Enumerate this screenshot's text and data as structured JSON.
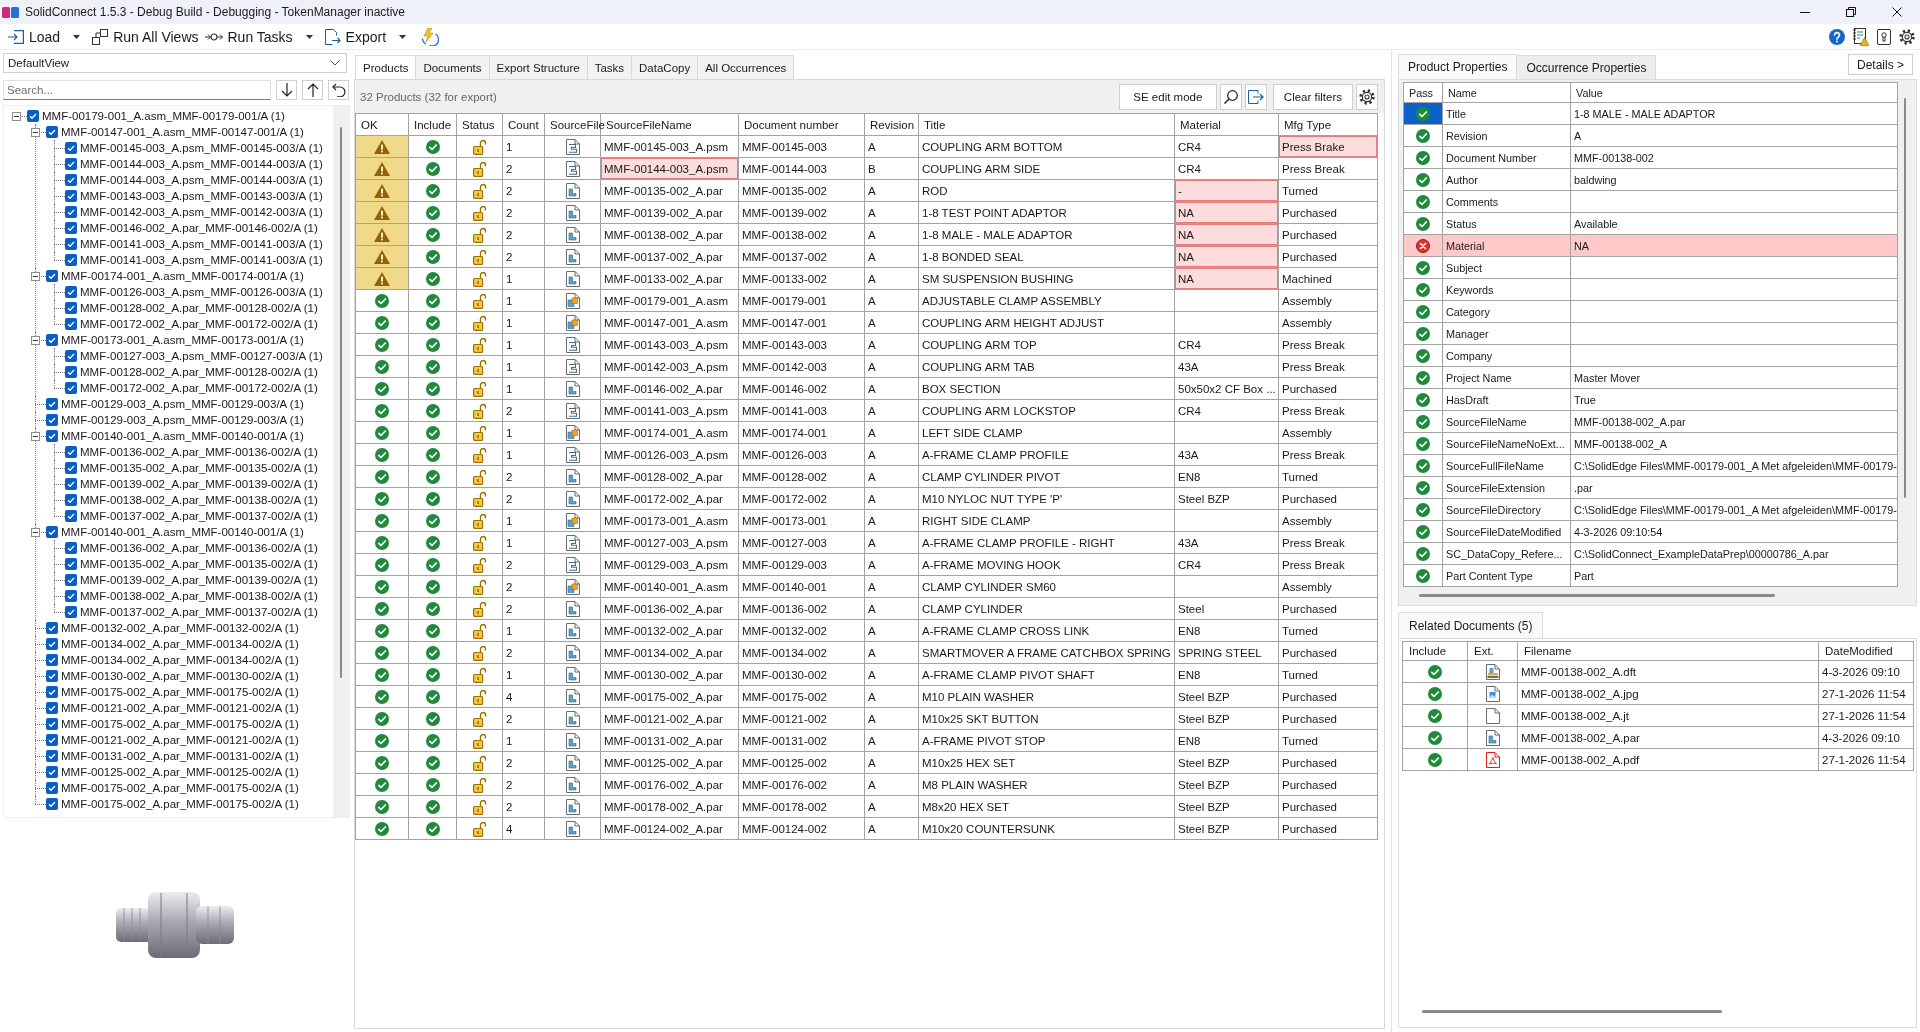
{
  "window": {
    "title": "SolidConnect 1.5.3 - Debug Build - Debugging - TokenManager inactive"
  },
  "toolbar": {
    "items": [
      {
        "label": "Load",
        "dropdown": true
      },
      {
        "label": "Run All Views",
        "dropdown": false
      },
      {
        "label": "Run Tasks",
        "dropdown": true
      },
      {
        "label": "Export",
        "dropdown": true
      }
    ]
  },
  "left_panel": {
    "view": {
      "value": "DefaultView"
    },
    "search": {
      "placeholder": "Search..."
    },
    "tree": [
      {
        "label": "MMF-00179-001_A.asm_MMF-00179-001/A (1)",
        "checked": true,
        "expanded": true,
        "children": [
          {
            "label": "MMF-00147-001_A.asm_MMF-00147-001/A (1)",
            "checked": true,
            "expanded": true,
            "children": [
              {
                "label": "MMF-00145-003_A.psm_MMF-00145-003/A (1)",
                "checked": true
              },
              {
                "label": "MMF-00144-003_A.psm_MMF-00144-003/A (1)",
                "checked": true
              },
              {
                "label": "MMF-00144-003_A.psm_MMF-00144-003/A (1)",
                "checked": true
              },
              {
                "label": "MMF-00143-003_A.psm_MMF-00143-003/A (1)",
                "checked": true
              },
              {
                "label": "MMF-00142-003_A.psm_MMF-00142-003/A (1)",
                "checked": true
              },
              {
                "label": "MMF-00146-002_A.par_MMF-00146-002/A (1)",
                "checked": true
              },
              {
                "label": "MMF-00141-003_A.psm_MMF-00141-003/A (1)",
                "checked": true
              },
              {
                "label": "MMF-00141-003_A.psm_MMF-00141-003/A (1)",
                "checked": true
              }
            ]
          },
          {
            "label": "MMF-00174-001_A.asm_MMF-00174-001/A (1)",
            "checked": true,
            "expanded": true,
            "children": [
              {
                "label": "MMF-00126-003_A.psm_MMF-00126-003/A (1)",
                "checked": true
              },
              {
                "label": "MMF-00128-002_A.par_MMF-00128-002/A (1)",
                "checked": true
              },
              {
                "label": "MMF-00172-002_A.par_MMF-00172-002/A (1)",
                "checked": true
              }
            ]
          },
          {
            "label": "MMF-00173-001_A.asm_MMF-00173-001/A (1)",
            "checked": true,
            "expanded": true,
            "children": [
              {
                "label": "MMF-00127-003_A.psm_MMF-00127-003/A (1)",
                "checked": true
              },
              {
                "label": "MMF-00128-002_A.par_MMF-00128-002/A (1)",
                "checked": true
              },
              {
                "label": "MMF-00172-002_A.par_MMF-00172-002/A (1)",
                "checked": true
              }
            ]
          },
          {
            "label": "MMF-00129-003_A.psm_MMF-00129-003/A (1)",
            "checked": true
          },
          {
            "label": "MMF-00129-003_A.psm_MMF-00129-003/A (1)",
            "checked": true
          },
          {
            "label": "MMF-00140-001_A.asm_MMF-00140-001/A (1)",
            "checked": true,
            "expanded": true,
            "children": [
              {
                "label": "MMF-00136-002_A.par_MMF-00136-002/A (1)",
                "checked": true
              },
              {
                "label": "MMF-00135-002_A.par_MMF-00135-002/A (1)",
                "checked": true
              },
              {
                "label": "MMF-00139-002_A.par_MMF-00139-002/A (1)",
                "checked": true
              },
              {
                "label": "MMF-00138-002_A.par_MMF-00138-002/A (1)",
                "checked": true
              },
              {
                "label": "MMF-00137-002_A.par_MMF-00137-002/A (1)",
                "checked": true
              }
            ]
          },
          {
            "label": "MMF-00140-001_A.asm_MMF-00140-001/A (1)",
            "checked": true,
            "expanded": true,
            "children": [
              {
                "label": "MMF-00136-002_A.par_MMF-00136-002/A (1)",
                "checked": true
              },
              {
                "label": "MMF-00135-002_A.par_MMF-00135-002/A (1)",
                "checked": true
              },
              {
                "label": "MMF-00139-002_A.par_MMF-00139-002/A (1)",
                "checked": true
              },
              {
                "label": "MMF-00138-002_A.par_MMF-00138-002/A (1)",
                "checked": true
              },
              {
                "label": "MMF-00137-002_A.par_MMF-00137-002/A (1)",
                "checked": true
              }
            ]
          },
          {
            "label": "MMF-00132-002_A.par_MMF-00132-002/A (1)",
            "checked": true
          },
          {
            "label": "MMF-00134-002_A.par_MMF-00134-002/A (1)",
            "checked": true
          },
          {
            "label": "MMF-00134-002_A.par_MMF-00134-002/A (1)",
            "checked": true
          },
          {
            "label": "MMF-00130-002_A.par_MMF-00130-002/A (1)",
            "checked": true
          },
          {
            "label": "MMF-00175-002_A.par_MMF-00175-002/A (1)",
            "checked": true
          },
          {
            "label": "MMF-00121-002_A.par_MMF-00121-002/A (1)",
            "checked": true
          },
          {
            "label": "MMF-00175-002_A.par_MMF-00175-002/A (1)",
            "checked": true
          },
          {
            "label": "MMF-00121-002_A.par_MMF-00121-002/A (1)",
            "checked": true
          },
          {
            "label": "MMF-00131-002_A.par_MMF-00131-002/A (1)",
            "checked": true
          },
          {
            "label": "MMF-00125-002_A.par_MMF-00125-002/A (1)",
            "checked": true
          },
          {
            "label": "MMF-00175-002_A.par_MMF-00175-002/A (1)",
            "checked": true
          },
          {
            "label": "MMF-00175-002_A.par_MMF-00175-002/A (1)",
            "checked": true
          }
        ]
      }
    ]
  },
  "products_panel": {
    "tabs": [
      {
        "label": "Products",
        "selected": true
      },
      {
        "label": "Documents",
        "selected": false
      },
      {
        "label": "Export Structure",
        "selected": false
      },
      {
        "label": "Tasks",
        "selected": false
      },
      {
        "label": "DataCopy",
        "selected": false
      },
      {
        "label": "All Occurrences",
        "selected": false
      }
    ],
    "summary": "32 Products (32 for export)",
    "edit_mode_button": "SE edit mode",
    "clear_filters_button": "Clear filters",
    "table": {
      "columns": [
        "OK",
        "Include",
        "Status",
        "Count",
        "SourceFile",
        "SourceFileName",
        "Document number",
        "Revision",
        "Title",
        "Material",
        "Mfg Type"
      ],
      "rows": [
        {
          "ok": false,
          "include": true,
          "count": "1",
          "kind": "sheetmetal",
          "source_file_name": "MMF-00145-003_A.psm",
          "document_number": "MMF-00145-003",
          "revision": "A",
          "title": "COUPLING ARM BOTTOM",
          "material": "CR4",
          "mfg_type": "Press Brake",
          "file_name_error": false,
          "material_error": false,
          "mfg_type_error": true
        },
        {
          "ok": false,
          "include": true,
          "count": "2",
          "kind": "sheetmetal",
          "source_file_name": "MMF-00144-003_A.psm",
          "document_number": "MMF-00144-003",
          "revision": "B",
          "title": "COUPLING ARM SIDE",
          "material": "CR4",
          "mfg_type": "Press Break",
          "file_name_error": true,
          "material_error": false,
          "mfg_type_error": false
        },
        {
          "ok": false,
          "include": true,
          "count": "2",
          "kind": "part",
          "source_file_name": "MMF-00135-002_A.par",
          "document_number": "MMF-00135-002",
          "revision": "A",
          "title": "ROD",
          "material": "-",
          "mfg_type": "Turned",
          "file_name_error": false,
          "material_error": true,
          "mfg_type_error": false
        },
        {
          "ok": false,
          "include": true,
          "count": "2",
          "kind": "part",
          "source_file_name": "MMF-00139-002_A.par",
          "document_number": "MMF-00139-002",
          "revision": "A",
          "title": "1-8 TEST POINT ADAPTOR",
          "material": "NA",
          "mfg_type": "Purchased",
          "file_name_error": false,
          "material_error": true,
          "mfg_type_error": false
        },
        {
          "ok": false,
          "include": true,
          "count": "2",
          "kind": "part",
          "source_file_name": "MMF-00138-002_A.par",
          "document_number": "MMF-00138-002",
          "revision": "A",
          "title": "1-8 MALE - MALE ADAPTOR",
          "material": "NA",
          "mfg_type": "Purchased",
          "file_name_error": false,
          "material_error": true,
          "mfg_type_error": false
        },
        {
          "ok": false,
          "include": true,
          "count": "2",
          "kind": "part",
          "source_file_name": "MMF-00137-002_A.par",
          "document_number": "MMF-00137-002",
          "revision": "A",
          "title": "1-8 BONDED SEAL",
          "material": "NA",
          "mfg_type": "Purchased",
          "file_name_error": false,
          "material_error": true,
          "mfg_type_error": false
        },
        {
          "ok": false,
          "include": true,
          "count": "1",
          "kind": "part",
          "source_file_name": "MMF-00133-002_A.par",
          "document_number": "MMF-00133-002",
          "revision": "A",
          "title": "SM SUSPENSION BUSHING",
          "material": "NA",
          "mfg_type": "Machined",
          "file_name_error": false,
          "material_error": true,
          "mfg_type_error": false
        },
        {
          "ok": true,
          "include": true,
          "count": "1",
          "kind": "assembly",
          "source_file_name": "MMF-00179-001_A.asm",
          "document_number": "MMF-00179-001",
          "revision": "A",
          "title": "ADJUSTABLE CLAMP ASSEMBLY",
          "mfg_type": "Assembly",
          "file_name_error": false,
          "material_error": false,
          "mfg_type_error": false
        },
        {
          "ok": true,
          "include": true,
          "count": "1",
          "kind": "assembly",
          "source_file_name": "MMF-00147-001_A.asm",
          "document_number": "MMF-00147-001",
          "revision": "A",
          "title": "COUPLING ARM HEIGHT ADJUST",
          "mfg_type": "Assembly",
          "file_name_error": false,
          "material_error": false,
          "mfg_type_error": false
        },
        {
          "ok": true,
          "include": true,
          "count": "1",
          "kind": "sheetmetal",
          "source_file_name": "MMF-00143-003_A.psm",
          "document_number": "MMF-00143-003",
          "revision": "A",
          "title": "COUPLING ARM TOP",
          "material": "CR4",
          "mfg_type": "Press Break",
          "file_name_error": false,
          "material_error": false,
          "mfg_type_error": false
        },
        {
          "ok": true,
          "include": true,
          "count": "1",
          "kind": "sheetmetal",
          "source_file_name": "MMF-00142-003_A.psm",
          "document_number": "MMF-00142-003",
          "revision": "A",
          "title": "COUPLING ARM TAB",
          "material": "43A",
          "mfg_type": "Press Break",
          "file_name_error": false,
          "material_error": false,
          "mfg_type_error": false
        },
        {
          "ok": true,
          "include": true,
          "count": "1",
          "kind": "part",
          "source_file_name": "MMF-00146-002_A.par",
          "document_number": "MMF-00146-002",
          "revision": "A",
          "title": "BOX SECTION",
          "material": "50x50x2 CF Box ...",
          "mfg_type": "Purchased",
          "file_name_error": false,
          "material_error": false,
          "mfg_type_error": false
        },
        {
          "ok": true,
          "include": true,
          "count": "2",
          "kind": "sheetmetal",
          "source_file_name": "MMF-00141-003_A.psm",
          "document_number": "MMF-00141-003",
          "revision": "A",
          "title": "COUPLING ARM LOCKSTOP",
          "material": "CR4",
          "mfg_type": "Press Break",
          "file_name_error": false,
          "material_error": false,
          "mfg_type_error": false
        },
        {
          "ok": true,
          "include": true,
          "count": "1",
          "kind": "assembly",
          "source_file_name": "MMF-00174-001_A.asm",
          "document_number": "MMF-00174-001",
          "revision": "A",
          "title": "LEFT SIDE CLAMP",
          "mfg_type": "Assembly",
          "file_name_error": false,
          "material_error": false,
          "mfg_type_error": false
        },
        {
          "ok": true,
          "include": true,
          "count": "1",
          "kind": "sheetmetal",
          "source_file_name": "MMF-00126-003_A.psm",
          "document_number": "MMF-00126-003",
          "revision": "A",
          "title": "A-FRAME CLAMP PROFILE",
          "material": "43A",
          "mfg_type": "Press Break",
          "file_name_error": false,
          "material_error": false,
          "mfg_type_error": false
        },
        {
          "ok": true,
          "include": true,
          "count": "2",
          "kind": "part",
          "source_file_name": "MMF-00128-002_A.par",
          "document_number": "MMF-00128-002",
          "revision": "A",
          "title": "CLAMP CYLINDER PIVOT",
          "material": "EN8",
          "mfg_type": "Turned",
          "file_name_error": false,
          "material_error": false,
          "mfg_type_error": false
        },
        {
          "ok": true,
          "include": true,
          "count": "2",
          "kind": "part",
          "source_file_name": "MMF-00172-002_A.par",
          "document_number": "MMF-00172-002",
          "revision": "A",
          "title": "M10 NYLOC NUT TYPE 'P'",
          "material": "Steel BZP",
          "mfg_type": "Purchased",
          "file_name_error": false,
          "material_error": false,
          "mfg_type_error": false
        },
        {
          "ok": true,
          "include": true,
          "count": "1",
          "kind": "assembly",
          "source_file_name": "MMF-00173-001_A.asm",
          "document_number": "MMF-00173-001",
          "revision": "A",
          "title": "RIGHT SIDE CLAMP",
          "mfg_type": "Assembly",
          "file_name_error": false,
          "material_error": false,
          "mfg_type_error": false
        },
        {
          "ok": true,
          "include": true,
          "count": "1",
          "kind": "sheetmetal",
          "source_file_name": "MMF-00127-003_A.psm",
          "document_number": "MMF-00127-003",
          "revision": "A",
          "title": "A-FRAME CLAMP PROFILE - RIGHT",
          "material": "43A",
          "mfg_type": "Press Break",
          "file_name_error": false,
          "material_error": false,
          "mfg_type_error": false
        },
        {
          "ok": true,
          "include": true,
          "count": "2",
          "kind": "sheetmetal",
          "source_file_name": "MMF-00129-003_A.psm",
          "document_number": "MMF-00129-003",
          "revision": "A",
          "title": "A-FRAME MOVING HOOK",
          "material": "CR4",
          "mfg_type": "Press Break",
          "file_name_error": false,
          "material_error": false,
          "mfg_type_error": false
        },
        {
          "ok": true,
          "include": true,
          "count": "2",
          "kind": "assembly",
          "source_file_name": "MMF-00140-001_A.asm",
          "document_number": "MMF-00140-001",
          "revision": "A",
          "title": "CLAMP CYLINDER SM60",
          "mfg_type": "Assembly",
          "file_name_error": false,
          "material_error": false,
          "mfg_type_error": false
        },
        {
          "ok": true,
          "include": true,
          "count": "2",
          "kind": "part",
          "source_file_name": "MMF-00136-002_A.par",
          "document_number": "MMF-00136-002",
          "revision": "A",
          "title": "CLAMP CYLINDER",
          "material": "Steel",
          "mfg_type": "Purchased",
          "file_name_error": false,
          "material_error": false,
          "mfg_type_error": false
        },
        {
          "ok": true,
          "include": true,
          "count": "1",
          "kind": "part",
          "source_file_name": "MMF-00132-002_A.par",
          "document_number": "MMF-00132-002",
          "revision": "A",
          "title": "A-FRAME CLAMP CROSS LINK",
          "material": "EN8",
          "mfg_type": "Turned",
          "file_name_error": false,
          "material_error": false,
          "mfg_type_error": false
        },
        {
          "ok": true,
          "include": true,
          "count": "2",
          "kind": "part",
          "source_file_name": "MMF-00134-002_A.par",
          "document_number": "MMF-00134-002",
          "revision": "A",
          "title": "SMARTMOVER A FRAME CATCHBOX SPRING",
          "material": "SPRING STEEL",
          "mfg_type": "Purchased",
          "file_name_error": false,
          "material_error": false,
          "mfg_type_error": false
        },
        {
          "ok": true,
          "include": true,
          "count": "1",
          "kind": "part",
          "source_file_name": "MMF-00130-002_A.par",
          "document_number": "MMF-00130-002",
          "revision": "A",
          "title": "A-FRAME CLAMP PIVOT SHAFT",
          "material": "EN8",
          "mfg_type": "Turned",
          "file_name_error": false,
          "material_error": false,
          "mfg_type_error": false
        },
        {
          "ok": true,
          "include": true,
          "count": "4",
          "kind": "part",
          "source_file_name": "MMF-00175-002_A.par",
          "document_number": "MMF-00175-002",
          "revision": "A",
          "title": "M10 PLAIN WASHER",
          "material": "Steel BZP",
          "mfg_type": "Purchased",
          "file_name_error": false,
          "material_error": false,
          "mfg_type_error": false
        },
        {
          "ok": true,
          "include": true,
          "count": "2",
          "kind": "part",
          "source_file_name": "MMF-00121-002_A.par",
          "document_number": "MMF-00121-002",
          "revision": "A",
          "title": "M10x25 SKT BUTTON",
          "material": "Steel BZP",
          "mfg_type": "Purchased",
          "file_name_error": false,
          "material_error": false,
          "mfg_type_error": false
        },
        {
          "ok": true,
          "include": true,
          "count": "1",
          "kind": "part",
          "source_file_name": "MMF-00131-002_A.par",
          "document_number": "MMF-00131-002",
          "revision": "A",
          "title": "A-FRAME PIVOT STOP",
          "material": "EN8",
          "mfg_type": "Turned",
          "file_name_error": false,
          "material_error": false,
          "mfg_type_error": false
        },
        {
          "ok": true,
          "include": true,
          "count": "2",
          "kind": "part",
          "source_file_name": "MMF-00125-002_A.par",
          "document_number": "MMF-00125-002",
          "revision": "A",
          "title": "M10x25 HEX SET",
          "material": "Steel BZP",
          "mfg_type": "Purchased",
          "file_name_error": false,
          "material_error": false,
          "mfg_type_error": false
        },
        {
          "ok": true,
          "include": true,
          "count": "2",
          "kind": "part",
          "source_file_name": "MMF-00176-002_A.par",
          "document_number": "MMF-00176-002",
          "revision": "A",
          "title": "M8 PLAIN WASHER",
          "material": "Steel BZP",
          "mfg_type": "Purchased",
          "file_name_error": false,
          "material_error": false,
          "mfg_type_error": false
        },
        {
          "ok": true,
          "include": true,
          "count": "2",
          "kind": "part",
          "source_file_name": "MMF-00178-002_A.par",
          "document_number": "MMF-00178-002",
          "revision": "A",
          "title": "M8x20 HEX SET",
          "material": "Steel BZP",
          "mfg_type": "Purchased",
          "file_name_error": false,
          "material_error": false,
          "mfg_type_error": false
        },
        {
          "ok": true,
          "include": true,
          "count": "4",
          "kind": "part",
          "source_file_name": "MMF-00124-002_A.par",
          "document_number": "MMF-00124-002",
          "revision": "A",
          "title": "M10x20 COUNTERSUNK",
          "material": "Steel BZP",
          "mfg_type": "Purchased",
          "file_name_error": false,
          "material_error": false,
          "mfg_type_error": false
        }
      ]
    }
  },
  "properties_panel": {
    "tabs": [
      {
        "label": "Product Properties",
        "selected": true
      },
      {
        "label": "Occurrence Properties",
        "selected": false
      }
    ],
    "details_button": "Details >",
    "grid": {
      "columns": [
        "Pass",
        "Name",
        "Value"
      ],
      "rows": [
        {
          "pass": true,
          "selected": true,
          "name": "Title",
          "value": "1-8 MALE - MALE ADAPTOR"
        },
        {
          "pass": true,
          "selected": false,
          "name": "Revision",
          "value": "A"
        },
        {
          "pass": true,
          "selected": false,
          "name": "Document Number",
          "value": "MMF-00138-002"
        },
        {
          "pass": true,
          "selected": false,
          "name": "Author",
          "value": "baldwing"
        },
        {
          "pass": true,
          "selected": false,
          "name": "Comments"
        },
        {
          "pass": true,
          "selected": false,
          "name": "Status",
          "value": "Available"
        },
        {
          "pass": false,
          "selected": false,
          "name": "Material",
          "value": "NA"
        },
        {
          "pass": true,
          "selected": false,
          "name": "Subject"
        },
        {
          "pass": true,
          "selected": false,
          "name": "Keywords"
        },
        {
          "pass": true,
          "selected": false,
          "name": "Category"
        },
        {
          "pass": true,
          "selected": false,
          "name": "Manager"
        },
        {
          "pass": true,
          "selected": false,
          "name": "Company"
        },
        {
          "pass": true,
          "selected": false,
          "name": "Project Name",
          "value": "Master Mover"
        },
        {
          "pass": true,
          "selected": false,
          "name": "HasDraft",
          "value": "True"
        },
        {
          "pass": true,
          "selected": false,
          "name": "SourceFileName",
          "value": "MMF-00138-002_A.par"
        },
        {
          "pass": true,
          "selected": false,
          "name": "SourceFileNameNoExt...",
          "value": "MMF-00138-002_A"
        },
        {
          "pass": true,
          "selected": false,
          "name": "SourceFullFileName",
          "value": "C:\\SolidEdge Files\\MMF-00179-001_A Met afgeleiden\\MMF-00179-"
        },
        {
          "pass": true,
          "selected": false,
          "name": "SourceFileExtension",
          "value": ".par"
        },
        {
          "pass": true,
          "selected": false,
          "name": "SourceFileDirectory",
          "value": "C:\\SolidEdge Files\\MMF-00179-001_A Met afgeleiden\\MMF-00179-"
        },
        {
          "pass": true,
          "selected": false,
          "name": "SourceFileDateModified",
          "value": "4-3-2026 09:10:54"
        },
        {
          "pass": true,
          "selected": false,
          "name": "SC_DataCopy_Refere...",
          "value": "C:\\SolidConnect_ExampleDataPrep\\00000786_A.par"
        },
        {
          "pass": true,
          "selected": false,
          "name": "Part Content Type",
          "value": "Part"
        }
      ]
    }
  },
  "related_documents": {
    "tab": "Related Documents (5)",
    "columns": [
      "Include",
      "Ext.",
      "Filename",
      "DateModified"
    ],
    "rows": [
      {
        "include": true,
        "kind": "drawing",
        "filename": "MMF-00138-002_A.dft",
        "date_modified": "4-3-2026 09:10"
      },
      {
        "include": true,
        "kind": "image",
        "filename": "MMF-00138-002_A.jpg",
        "date_modified": "27-1-2026 11:54"
      },
      {
        "include": true,
        "kind": "blank",
        "filename": "MMF-00138-002_A.jt",
        "date_modified": "27-1-2026 11:54"
      },
      {
        "include": true,
        "kind": "part",
        "filename": "MMF-00138-002_A.par",
        "date_modified": "4-3-2026 09:10"
      },
      {
        "include": true,
        "kind": "pdf",
        "filename": "MMF-00138-002_A.pdf",
        "date_modified": "27-1-2026 11:54"
      }
    ]
  }
}
